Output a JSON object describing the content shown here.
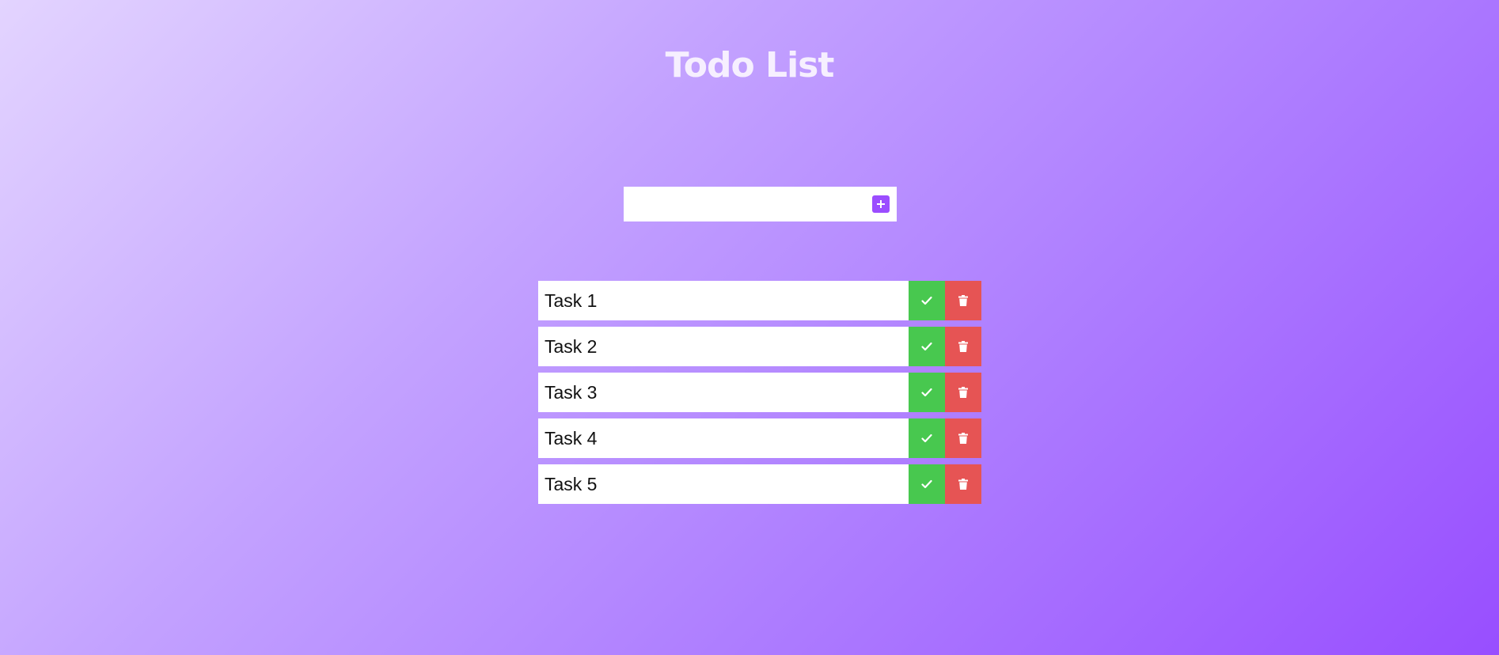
{
  "header": {
    "title": "Todo List"
  },
  "add_form": {
    "input_value": "",
    "add_icon": "plus-square-icon"
  },
  "tasks": [
    {
      "label": "Task 1"
    },
    {
      "label": "Task 2"
    },
    {
      "label": "Task 3"
    },
    {
      "label": "Task 4"
    },
    {
      "label": "Task 5"
    }
  ],
  "actions": {
    "complete_icon": "check-icon",
    "delete_icon": "trash-icon"
  },
  "colors": {
    "background_start": "#e3d4ff",
    "background_end": "#984eff",
    "accent": "#9b4dff",
    "complete": "#48c84f",
    "delete": "#e65454",
    "title": "#f6efff"
  }
}
